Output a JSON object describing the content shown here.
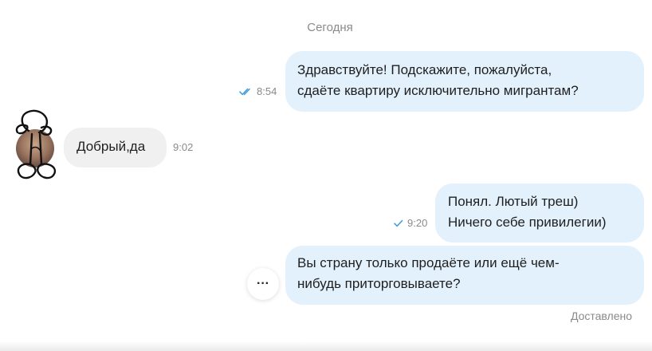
{
  "date_separator": "Сегодня",
  "messages": [
    {
      "direction": "out",
      "lines": [
        "Здравствуйте! Подскажите, пожалуйста,",
        "сдаёте квартиру исключительно мигрантам?"
      ],
      "time": "8:54",
      "status_icon": "double-check-icon"
    },
    {
      "direction": "in",
      "lines": [
        "Добрый,да"
      ],
      "time": "9:02"
    },
    {
      "direction": "out",
      "lines": [
        "Понял. Лютый треш)",
        "Ничего себе привилегии)"
      ],
      "time": "9:20",
      "status_icon": "check-icon"
    },
    {
      "direction": "out",
      "lines": [
        "Вы страну только продаёте или ещё чем-",
        "нибудь приторговываете?"
      ]
    }
  ],
  "more_button_label": "···",
  "delivered_label": "Доставлено",
  "colors": {
    "outgoing_bubble": "#e3f1fc",
    "incoming_bubble": "#f0f0f0",
    "check_color": "#3a9bd9",
    "meta_text": "#8a8a8a"
  }
}
